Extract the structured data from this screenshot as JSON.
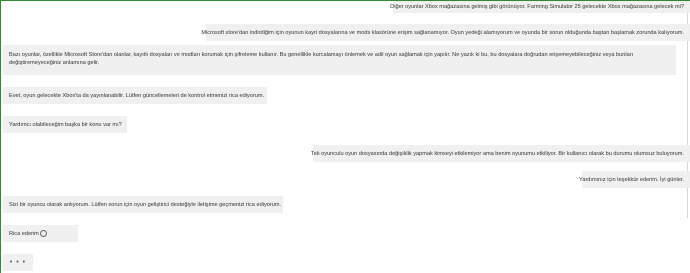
{
  "messages": [
    {
      "role": "user",
      "text": "Diğer oyunlar Xbox mağazasına gelmiş gibi görünüyor. Farming Simulator 25 gelecekte Xbox mağazasına gelecek mi?"
    },
    {
      "role": "user",
      "text": "Microsoft store'dan indirdiğim için oyunun kayıt dosyalarına ve mods klasörüne erişim sağlanamıyor. Oyun yedeği alamıyorum ve oyunda bir sorun olduğunda baştan başlamak zorunda kalıyorum."
    },
    {
      "role": "assistant",
      "text": "Bazı oyunlar, özellikle Microsoft Store'dan olanlar, kayıtlı dosyaları ve modları korumak için şifreleme kullanır. Bu genellikle kurcalamayı önlemek ve adil oyun sağlamak için yapılır. Ne yazık ki bu, bu dosyalara doğrudan erişemeyebileceğiniz veya bunları değiştiremeyeceğiniz anlamına gelir."
    },
    {
      "role": "assistant",
      "text": "Evet, oyun gelecekte Xbox'ta da yayınlanabilir. Lütfen güncellemeleri de kontrol etmenizi rica ediyorum."
    },
    {
      "role": "assistant",
      "text": "Yardımcı olabileceğim başka bir konu var mı?"
    },
    {
      "role": "user",
      "text": "Tek oyunculu oyun dosyasında değişiklik yapmak kimseyi etkilemiyor ama benim oyunumu etkiliyor. Bir kullanıcı olarak bu durumu olumsuz buluyorum."
    },
    {
      "role": "user",
      "text": "Yardımınız için teşekkür ederim. İyi günler."
    },
    {
      "role": "assistant",
      "text": "Sizi bir oyuncu olarak anlıyorum. Lütfen sorun için oyun geliştirici desteğiyle iletişime geçmenizi rica ediyorum."
    },
    {
      "role": "assistant",
      "text": "Rica ederim"
    }
  ],
  "typing_indicator": "• • •",
  "icons": {
    "emoji": "smiley-icon"
  },
  "colors": {
    "bubble": "#f0f0f0",
    "accent": "#2f8a2f"
  }
}
